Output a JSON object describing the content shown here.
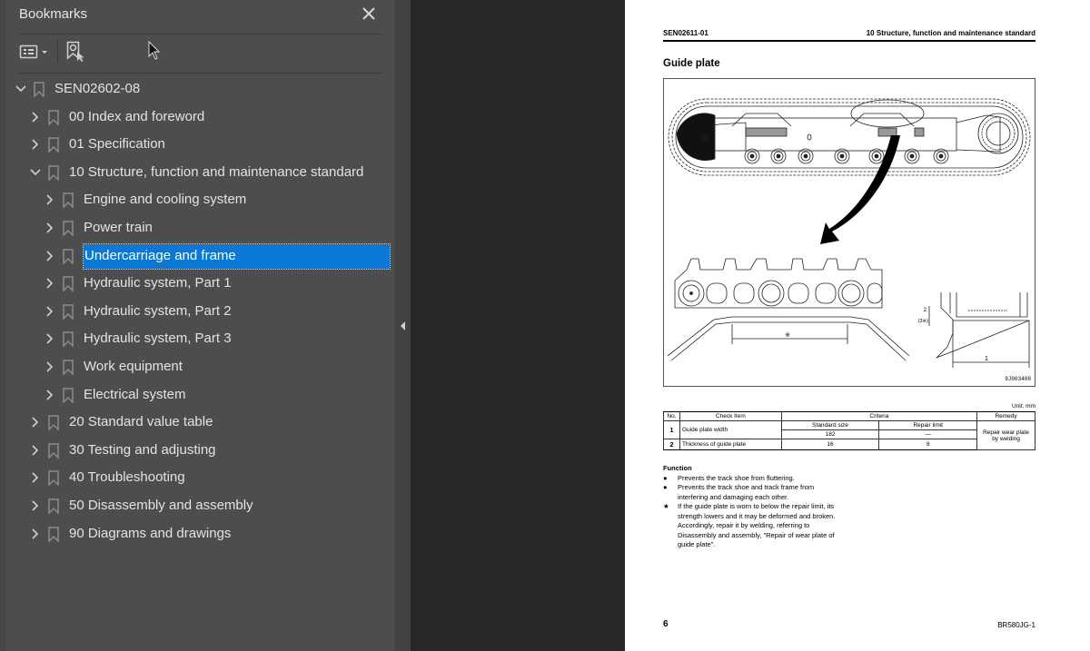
{
  "bookmarks_panel": {
    "title": "Bookmarks",
    "close_icon": "close-icon",
    "toolbar": {
      "options_icon": "list-options-icon",
      "find_current_icon": "find-current-bookmark-icon"
    },
    "collapse_icon": "collapse-left-icon",
    "tree": [
      {
        "label": "SEN02602-08",
        "level": 0,
        "expanded": true
      },
      {
        "label": "00 Index and foreword",
        "level": 1,
        "expanded": false
      },
      {
        "label": "01 Specification",
        "level": 1,
        "expanded": false
      },
      {
        "label": "10 Structure, function and maintenance standard",
        "level": 1,
        "expanded": true
      },
      {
        "label": "Engine and cooling system",
        "level": 2,
        "expanded": false
      },
      {
        "label": "Power train",
        "level": 2,
        "expanded": false
      },
      {
        "label": "Undercarriage and frame",
        "level": 2,
        "expanded": false,
        "selected": true
      },
      {
        "label": "Hydraulic system, Part 1",
        "level": 2,
        "expanded": false
      },
      {
        "label": "Hydraulic system, Part 2",
        "level": 2,
        "expanded": false
      },
      {
        "label": "Hydraulic system, Part 3",
        "level": 2,
        "expanded": false
      },
      {
        "label": "Work equipment",
        "level": 2,
        "expanded": false
      },
      {
        "label": "Electrical system",
        "level": 2,
        "expanded": false
      },
      {
        "label": "20 Standard value table",
        "level": 1,
        "expanded": false
      },
      {
        "label": "30 Testing and adjusting",
        "level": 1,
        "expanded": false
      },
      {
        "label": "40 Troubleshooting",
        "level": 1,
        "expanded": false
      },
      {
        "label": "50 Disassembly and assembly",
        "level": 1,
        "expanded": false
      },
      {
        "label": "90 Diagrams and drawings",
        "level": 1,
        "expanded": false
      }
    ]
  },
  "page": {
    "header_left": "SEN02611-01",
    "header_right": "10 Structure, function and maintenance standard",
    "heading": "Guide plate",
    "figure_id": "9J003408",
    "figure_labels": {
      "dim_main": "※",
      "dim_1": "1",
      "dim_2": "2",
      "dim_3": "(3※)"
    },
    "unit": "Unit: mm",
    "table": {
      "headers": {
        "no": "No.",
        "check_item": "Check Item",
        "criteria": "Criteria",
        "remedy": "Remedy"
      },
      "sub_headers": {
        "standard_size": "Standard size",
        "repair_limit": "Repair limit"
      },
      "rows": [
        {
          "no": "1",
          "item": "Guide plate width",
          "standard": "182",
          "limit": "—"
        },
        {
          "no": "2",
          "item": "Thickness of guide plate",
          "standard": "16",
          "limit": "8"
        }
      ],
      "remedy": "Repair wear plate by welding"
    },
    "function": {
      "title": "Function",
      "items": [
        {
          "mark": "●",
          "text": "Prevents the track shoe from fluttering."
        },
        {
          "mark": "●",
          "text": "Prevents the track shoe and track frame from interfering and damaging each other."
        },
        {
          "mark": "★",
          "text": "If the guide plate is worn to below the repair limit, its strength lowers and it may be deformed and broken. Accordingly, repair it by welding, referring to Disassembly and assembly, \"Repair of wear plate of guide plate\"."
        }
      ]
    },
    "page_number": "6",
    "model": "BR580JG-1"
  }
}
